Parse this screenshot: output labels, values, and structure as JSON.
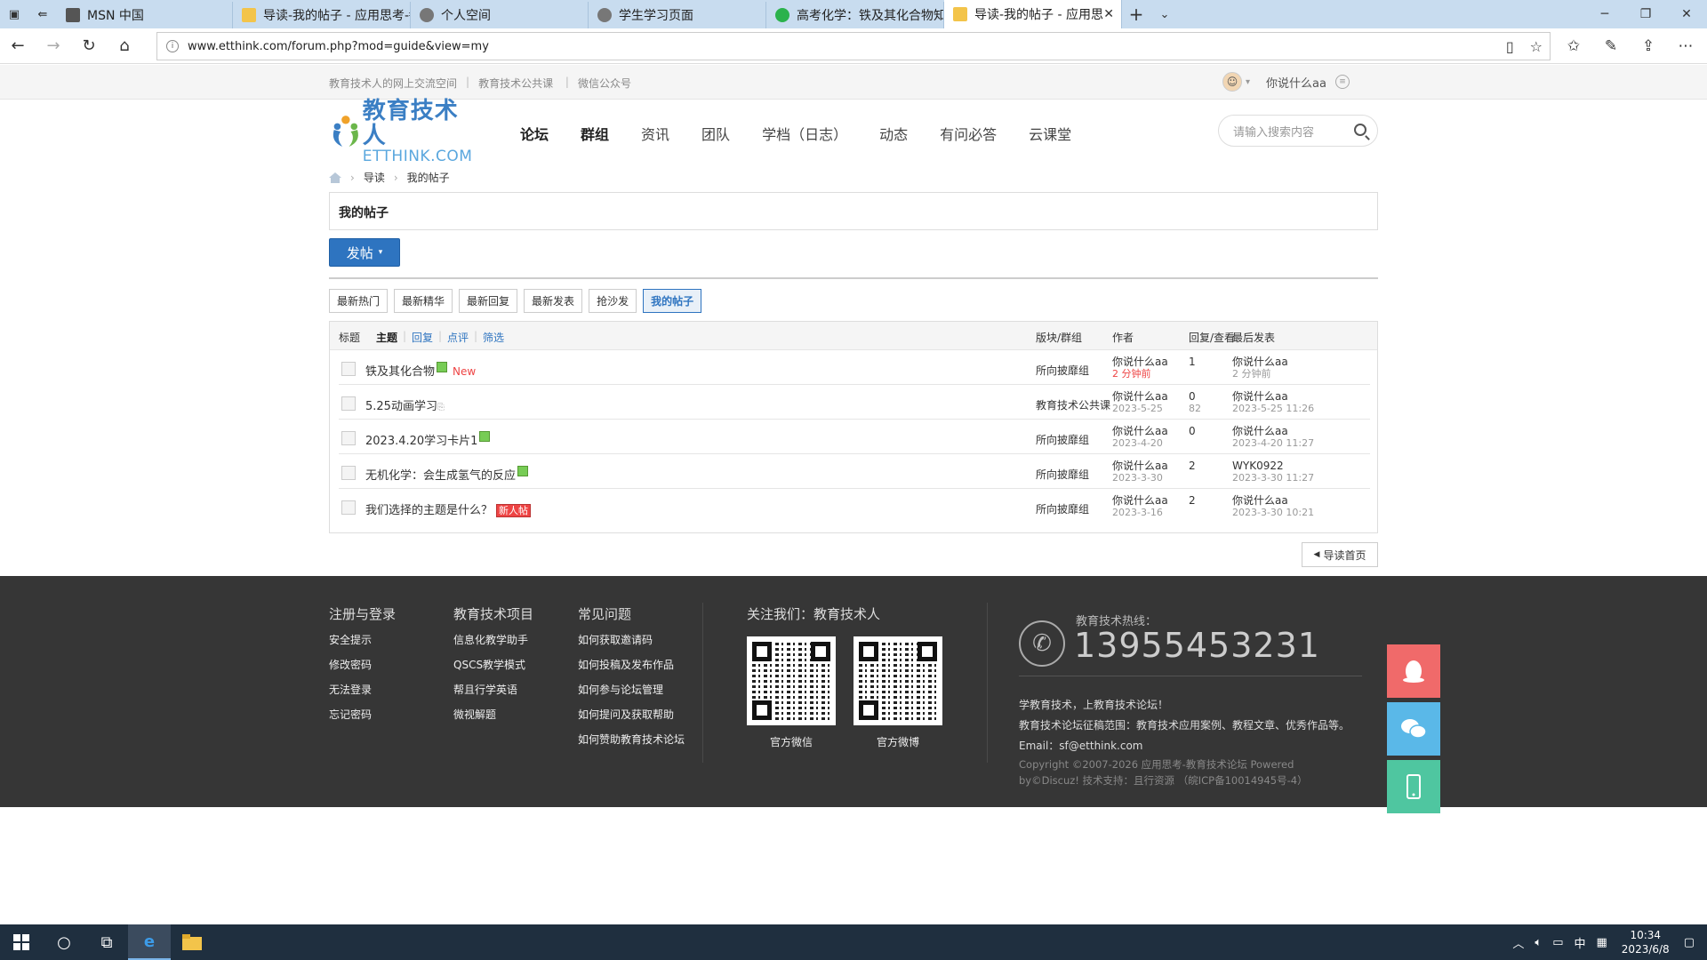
{
  "browser": {
    "tabs": [
      {
        "label": "MSN 中国",
        "color": "#555"
      },
      {
        "label": "导读-我的帖子 - 应用思考-ŧ",
        "color": "#f3c44a"
      },
      {
        "label": "个人空间",
        "color": "#777"
      },
      {
        "label": "学生学习页面",
        "color": "#777"
      },
      {
        "label": "高考化学：铁及其化合物知",
        "color": "#2bb24c"
      },
      {
        "label": "导读-我的帖子 - 应用思",
        "color": "#f3c44a"
      }
    ],
    "url": "www.etthink.com/forum.php?mod=guide&view=my"
  },
  "site": {
    "toplinks": [
      "教育技术人的网上交流空间",
      "教育技术公共课",
      "微信公众号"
    ],
    "username": "你说什么aa",
    "logo": {
      "cn": "教育技术人",
      "en": "ETTHINK.COM"
    },
    "nav": [
      "论坛",
      "群组",
      "资讯",
      "团队",
      "学档（日志）",
      "动态",
      "有问必答",
      "云课堂"
    ],
    "search_placeholder": "请输入搜索内容",
    "breadcrumb": [
      "导读",
      "我的帖子"
    ],
    "page_title": "我的帖子",
    "post_button": "发帖",
    "filters": [
      "最新热门",
      "最新精华",
      "最新回复",
      "最新发表",
      "抢沙发",
      "我的帖子"
    ],
    "table_head": {
      "title": "标题",
      "tabs": [
        "主题",
        "回复",
        "点评",
        "筛选"
      ],
      "forum": "版块/群组",
      "author": "作者",
      "replies": "回复/查看",
      "last": "最后发表"
    },
    "threads": [
      {
        "title": "铁及其化合物",
        "tag": "New",
        "forum": "所向披靡组",
        "author": "你说什么aa",
        "date": "2 分钟前",
        "replies": "1",
        "views": "",
        "last_user": "你说什么aa",
        "last_date": "2 分钟前"
      },
      {
        "title": "5.25动画学习",
        "tag": "",
        "forum": "教育技术公共课",
        "author": "你说什么aa",
        "date": "2023-5-25",
        "replies": "0",
        "views": "82",
        "last_user": "你说什么aa",
        "last_date": "2023-5-25 11:26"
      },
      {
        "title": "2023.4.20学习卡片1",
        "tag": "",
        "forum": "所向披靡组",
        "author": "你说什么aa",
        "date": "2023-4-20",
        "replies": "0",
        "views": "",
        "last_user": "你说什么aa",
        "last_date": "2023-4-20 11:27"
      },
      {
        "title": "无机化学：会生成氢气的反应",
        "tag": "",
        "forum": "所向披靡组",
        "author": "你说什么aa",
        "date": "2023-3-30",
        "replies": "2",
        "views": "",
        "last_user": "WYK0922",
        "last_date": "2023-3-30 11:27"
      },
      {
        "title": "我们选择的主题是什么？",
        "tag": "新人帖",
        "forum": "所向披靡组",
        "author": "你说什么aa",
        "date": "2023-3-16",
        "replies": "2",
        "views": "",
        "last_user": "你说什么aa",
        "last_date": "2023-3-30 10:21"
      }
    ],
    "back_button": "导读首页"
  },
  "footer": {
    "col1": {
      "title": "注册与登录",
      "items": [
        "安全提示",
        "修改密码",
        "无法登录",
        "忘记密码"
      ]
    },
    "col2": {
      "title": "教育技术项目",
      "items": [
        "信息化教学助手",
        "QSCS教学模式",
        "帮且行学英语",
        "微视解题"
      ]
    },
    "col3": {
      "title": "常见问题",
      "items": [
        "如何获取邀请码",
        "如何投稿及发布作品",
        "如何参与论坛管理",
        "如何提问及获取帮助",
        "如何赞助教育技术论坛"
      ]
    },
    "follow": "关注我们：教育技术人",
    "qr1_label": "官方微信",
    "qr2_label": "官方微博",
    "hotline_label": "教育技术热线：",
    "hotline": "13955453231",
    "info1": "学教育技术，上教育技术论坛！",
    "info2": "教育技术论坛征稿范围：教育技术应用案例、教程文章、优秀作品等。",
    "email": "Email：sf@etthink.com",
    "copy1": "Copyright ©2007-2026 应用思考-教育技术论坛 Powered",
    "copy2": "by©Discuz! 技术支持：且行资源 （皖ICP备10014945号-4）"
  },
  "taskbar": {
    "time": "10:34",
    "date": "2023/6/8",
    "ime": "中"
  },
  "colors": {
    "accent": "#2e74c0",
    "footer_bg": "#363636",
    "qq": "#f06a6a",
    "wechat": "#5ab8e8",
    "mobile": "#4fc6a0"
  }
}
